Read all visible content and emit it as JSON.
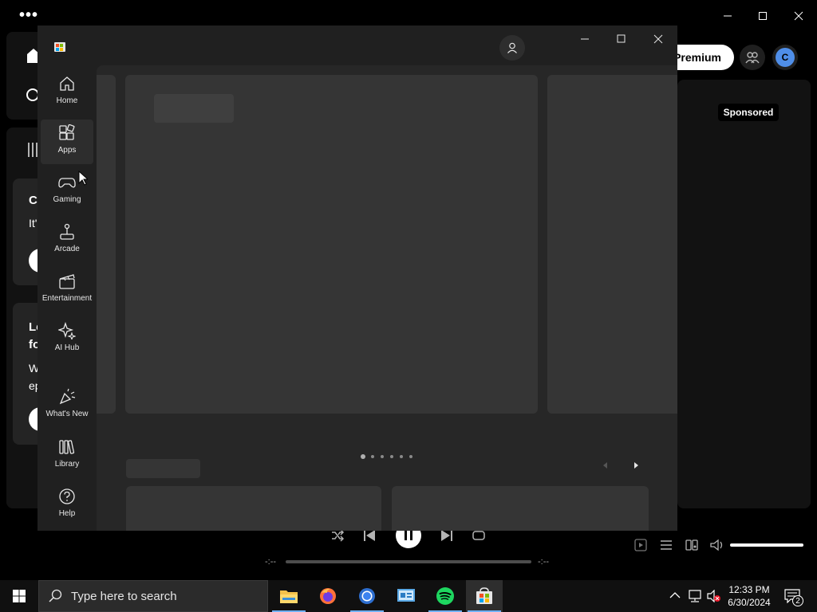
{
  "spotify": {
    "premium_label": "Premium",
    "avatar_initial": "C",
    "sponsored_label": "Sponsored",
    "time_elapsed": "-:--",
    "time_total": "-:--",
    "left_cards": [
      {
        "title_fragment": "C",
        "sub_fragment": "It'"
      },
      {
        "title_fragment": "Le\nfo",
        "sub_fragment": "W\nep"
      }
    ]
  },
  "store": {
    "nav": [
      {
        "label": "Home",
        "icon": "home-icon"
      },
      {
        "label": "Apps",
        "icon": "apps-icon",
        "active": true
      },
      {
        "label": "Gaming",
        "icon": "gamepad-icon"
      },
      {
        "label": "Arcade",
        "icon": "joystick-icon"
      },
      {
        "label": "Entertainment",
        "icon": "clapperboard-icon"
      },
      {
        "label": "AI Hub",
        "icon": "sparkle-icon"
      },
      {
        "label": "What's New",
        "icon": "party-popper-icon"
      },
      {
        "label": "Library",
        "icon": "library-icon"
      },
      {
        "label": "Help",
        "icon": "help-icon"
      }
    ],
    "carousel_pages": 6,
    "carousel_active_index": 0
  },
  "taskbar": {
    "search_placeholder": "Type here to search",
    "time": "12:33 PM",
    "date": "6/30/2024",
    "notification_count": "2",
    "apps": [
      "file-explorer-icon",
      "firefox-icon",
      "chrome-icon",
      "control-panel-icon",
      "spotify-icon",
      "microsoft-store-icon"
    ]
  },
  "colors": {
    "spotify_green": "#1ed760",
    "accent_blue": "#4f8ee8",
    "taskbar_underline": "#6fb1f5"
  }
}
